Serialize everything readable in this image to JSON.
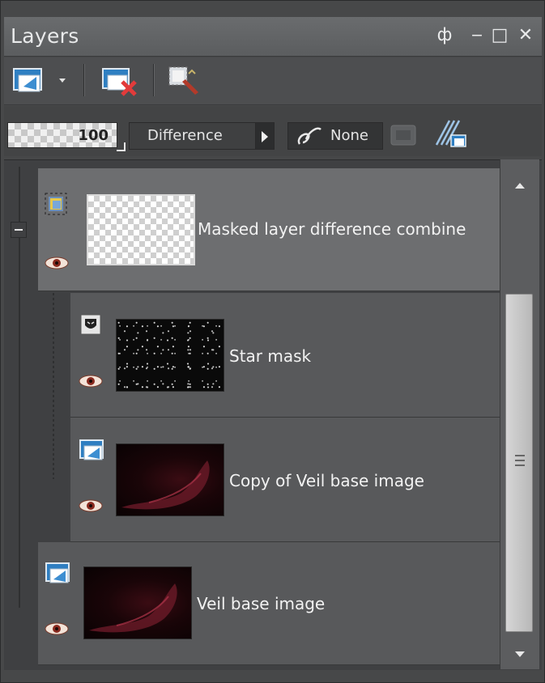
{
  "window": {
    "title": "Layers",
    "controls": {
      "pin": "ф",
      "minimize": "‒",
      "maximize": "□",
      "close": "✕"
    }
  },
  "toolbar": {
    "icons": [
      "new-layer-icon",
      "delete-layer-icon",
      "layer-properties-icon"
    ]
  },
  "options": {
    "opacity": "100",
    "blend_mode": "Difference",
    "mask_mode": "None"
  },
  "layers": [
    {
      "name": "Masked layer difference combine",
      "type": "group",
      "visible": true
    },
    {
      "name": "Star mask",
      "type": "mask",
      "visible": true
    },
    {
      "name": "Copy of Veil base image",
      "type": "raster",
      "visible": true
    },
    {
      "name": "Veil base image",
      "type": "raster",
      "visible": true
    }
  ],
  "colors": {
    "panel_bg": "#474849",
    "selected_row": "#6d6e70",
    "row_bg": "#58595b",
    "text": "#f2f2f2"
  }
}
